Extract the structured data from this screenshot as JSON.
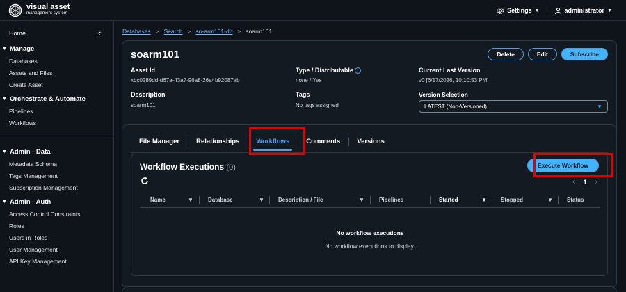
{
  "app": {
    "title": "visual asset",
    "subtitle": "management system",
    "settings_label": "Settings",
    "user_label": "administrator"
  },
  "sidebar": {
    "home": "Home",
    "sections": [
      {
        "title": "Manage",
        "items": [
          "Databases",
          "Assets and Files",
          "Create Asset"
        ]
      },
      {
        "title": "Orchestrate & Automate",
        "items": [
          "Pipelines",
          "Workflows"
        ]
      },
      {
        "title": "Admin - Data",
        "items": [
          "Metadata Schema",
          "Tags Management",
          "Subscription Management"
        ]
      },
      {
        "title": "Admin - Auth",
        "items": [
          "Access Control Constraints",
          "Roles",
          "Users in Roles",
          "User Management",
          "API Key Management"
        ]
      }
    ]
  },
  "breadcrumb": {
    "items": [
      "Databases",
      "Search",
      "so-arm101-db"
    ],
    "current": "soarm101"
  },
  "asset": {
    "name": "soarm101",
    "buttons": {
      "delete": "Delete",
      "edit": "Edit",
      "subscribe": "Subscribe"
    },
    "asset_id_label": "Asset Id",
    "asset_id": "xbc0289dd-d67a-43a7-96a8-26a4b92087ab",
    "type_label": "Type / Distributable",
    "type_value": "none / Yes",
    "current_version_label": "Current Last Version",
    "current_version_value": "v0 [6/17/2026, 10:10:53 PM]",
    "description_label": "Description",
    "description_value": "soarm101",
    "tags_label": "Tags",
    "tags_value": "No tags assigned",
    "version_selection_label": "Version Selection",
    "version_selection_value": "LATEST (Non-Versioned)"
  },
  "tabs": [
    "File Manager",
    "Relationships",
    "Workflows",
    "Comments",
    "Versions"
  ],
  "active_tab": "Workflows",
  "workflow": {
    "title": "Workflow Executions",
    "count": "(0)",
    "execute_label": "Execute Workflow",
    "page": "1",
    "columns": [
      "Name",
      "Database",
      "Description / File",
      "Pipelines",
      "Started",
      "Stopped",
      "Status"
    ],
    "empty_title": "No workflow executions",
    "empty_text": "No workflow executions to display."
  },
  "colors": {
    "accent": "#539fe5",
    "primary_button": "#42b4ff",
    "highlight": "#e30000",
    "background": "#0f141a"
  }
}
